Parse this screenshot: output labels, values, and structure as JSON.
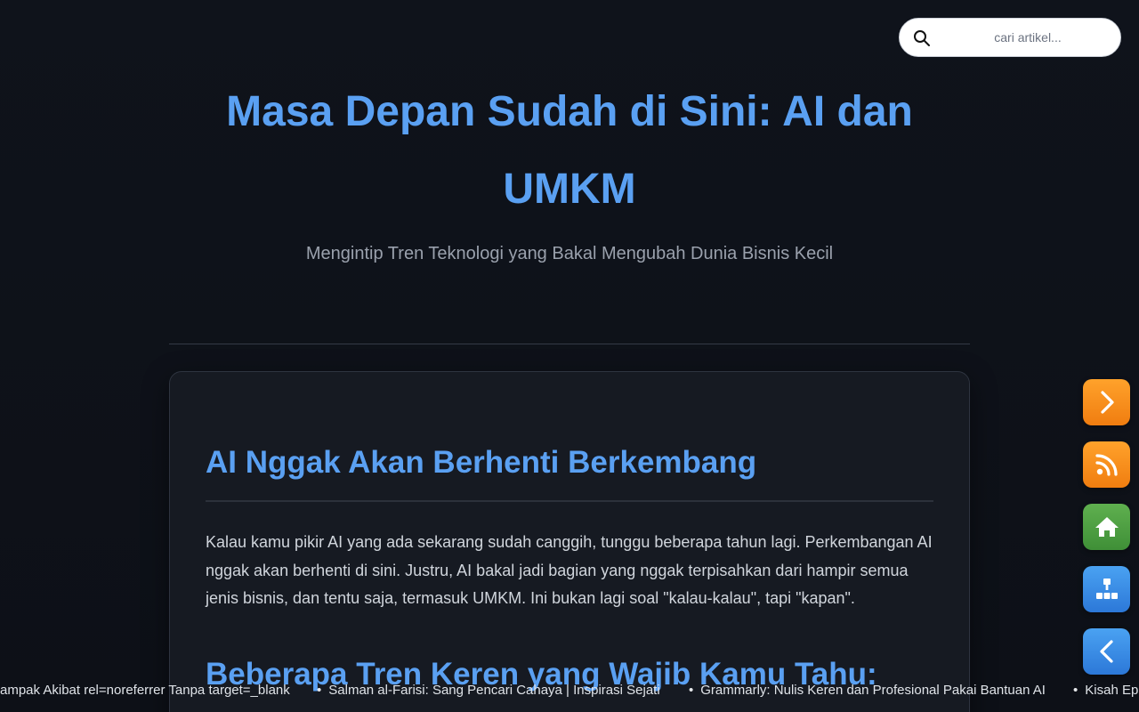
{
  "search": {
    "placeholder": "cari artikel...",
    "icon": "search-icon"
  },
  "header": {
    "title": "Masa Depan Sudah di Sini: AI dan UMKM",
    "subtitle": "Mengintip Tren Teknologi yang Bakal Mengubah Dunia Bisnis Kecil"
  },
  "article": {
    "heading1": "AI Nggak Akan Berhenti Berkembang",
    "paragraph1": "Kalau kamu pikir AI yang ada sekarang sudah canggih, tunggu beberapa tahun lagi. Perkembangan AI nggak akan berhenti di sini. Justru, AI bakal jadi bagian yang nggak terpisahkan dari hampir semua jenis bisnis, dan tentu saja, termasuk UMKM. Ini bukan lagi soal \"kalau-kalau\", tapi \"kapan\".",
    "heading2": "Beberapa Tren Keren yang Wajib Kamu Tahu:"
  },
  "ticker": {
    "items": [
      "ampak Akibat rel=noreferrer Tanpa target=_blank",
      "Salman al-Farisi: Sang Pencari Cahaya | Inspirasi Sejati",
      "Grammarly: Nulis Keren dan Profesional Pakai Bantuan AI",
      "Kisah Epi"
    ],
    "bullet": "•"
  },
  "side_nav": {
    "next": "chevron-right-icon",
    "rss": "rss-icon",
    "home": "home-icon",
    "sitemap": "sitemap-icon",
    "prev": "chevron-left-icon",
    "colors": {
      "orange": "#f58a18",
      "green": "#4fa043",
      "blue": "#3a8ce6"
    }
  },
  "colors": {
    "accent": "#5aa0f2",
    "background": "#0f131b",
    "card": "#161a22"
  }
}
